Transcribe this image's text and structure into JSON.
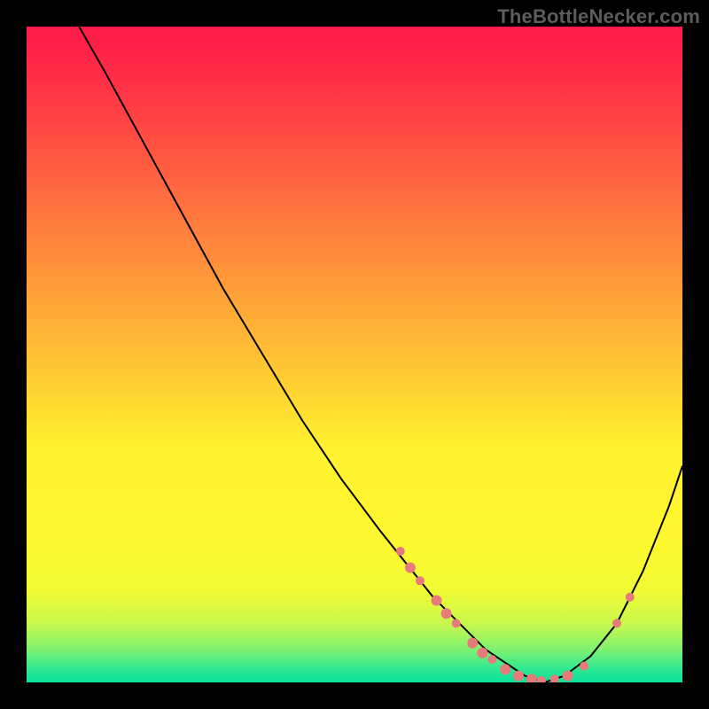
{
  "watermark": "TheBottleNecker.com",
  "chart_data": {
    "type": "line",
    "title": "",
    "xlabel": "",
    "ylabel": "",
    "xlim": [
      0,
      100
    ],
    "ylim": [
      0,
      100
    ],
    "series": [
      {
        "name": "curve",
        "x": [
          8,
          12,
          18,
          24,
          30,
          36,
          42,
          48,
          54,
          58,
          62,
          66,
          70,
          73,
          76,
          79,
          82,
          86,
          90,
          94,
          98,
          100
        ],
        "y": [
          100,
          93,
          82,
          71,
          60,
          50,
          40,
          31,
          23,
          18,
          13,
          9,
          5,
          3,
          1,
          0,
          1,
          4,
          9,
          17,
          27,
          33
        ]
      }
    ],
    "markers": [
      {
        "x": 57.0,
        "y": 20.0,
        "r": 5
      },
      {
        "x": 58.5,
        "y": 17.5,
        "r": 6
      },
      {
        "x": 60.0,
        "y": 15.5,
        "r": 5
      },
      {
        "x": 62.5,
        "y": 12.5,
        "r": 6
      },
      {
        "x": 64.0,
        "y": 10.5,
        "r": 6
      },
      {
        "x": 65.5,
        "y": 9.0,
        "r": 5
      },
      {
        "x": 68.0,
        "y": 6.0,
        "r": 6
      },
      {
        "x": 69.5,
        "y": 4.5,
        "r": 6
      },
      {
        "x": 71.0,
        "y": 3.5,
        "r": 5
      },
      {
        "x": 73.0,
        "y": 2.0,
        "r": 6
      },
      {
        "x": 75.0,
        "y": 1.0,
        "r": 6
      },
      {
        "x": 77.0,
        "y": 0.5,
        "r": 6
      },
      {
        "x": 78.5,
        "y": 0.3,
        "r": 5
      },
      {
        "x": 80.5,
        "y": 0.5,
        "r": 5
      },
      {
        "x": 82.5,
        "y": 1.0,
        "r": 6
      },
      {
        "x": 85.0,
        "y": 2.5,
        "r": 5
      },
      {
        "x": 90.0,
        "y": 9.0,
        "r": 5
      },
      {
        "x": 92.0,
        "y": 13.0,
        "r": 5
      }
    ]
  },
  "colors": {
    "curve": "#000000",
    "marker": "#e77b7b",
    "background_top": "#ff1a49",
    "background_bottom": "#09e29e",
    "frame": "#000000"
  }
}
